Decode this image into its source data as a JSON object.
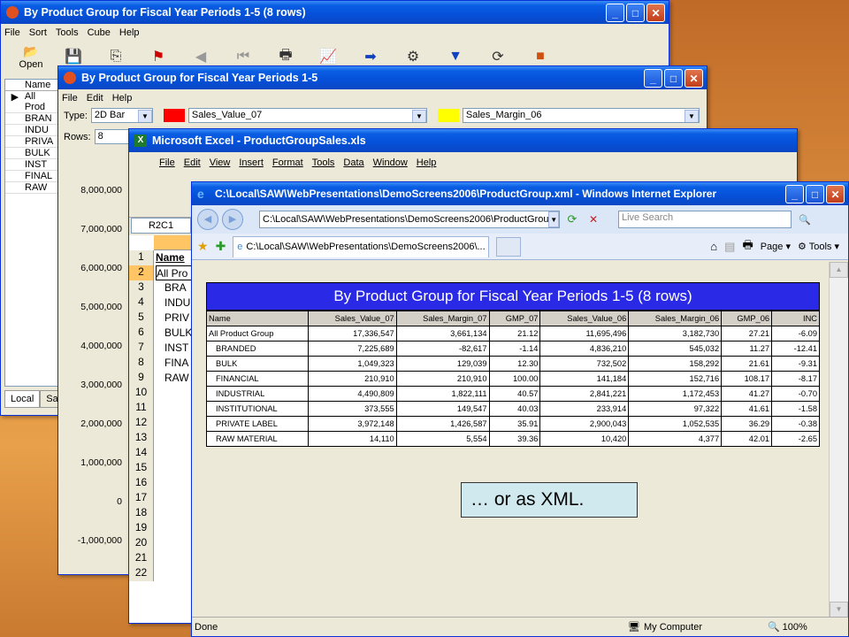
{
  "cube_window": {
    "title": "By Product Group for Fiscal Year Periods 1-5  (8 rows)",
    "menu": [
      "File",
      "Sort",
      "Tools",
      "Cube",
      "Help"
    ],
    "open_label": "Open",
    "rows": [
      "Name",
      "All Prod",
      "BRAN",
      "INDU",
      "PRIVA",
      "BULK",
      "INST",
      "FINAL",
      "RAW"
    ],
    "tabs": [
      "Local",
      "Sa"
    ]
  },
  "chart_window": {
    "title": "By Product Group for Fiscal Year Periods 1-5",
    "menu": [
      "File",
      "Edit",
      "Help"
    ],
    "type_label": "Type:",
    "type_value": "2D Bar",
    "series1": "Sales_Value_07",
    "series2": "Sales_Margin_06",
    "rows_label": "Rows:",
    "rows_value": "8",
    "y_ticks": [
      "8,000,000",
      "7,000,000",
      "6,000,000",
      "5,000,000",
      "4,000,000",
      "3,000,000",
      "2,000,000",
      "1,000,000",
      "0",
      "-1,000,000"
    ],
    "color1": "#ff0000",
    "color2": "#ffff00"
  },
  "excel_window": {
    "title": "Microsoft Excel - ProductGroupSales.xls",
    "menu": [
      "File",
      "Edit",
      "View",
      "Insert",
      "Format",
      "Tools",
      "Data",
      "Window",
      "Help"
    ],
    "name_box": "R2C1",
    "row_numbers": [
      "1",
      "2",
      "3",
      "4",
      "5",
      "6",
      "7",
      "8",
      "9",
      "10",
      "11",
      "12",
      "13",
      "14",
      "15",
      "16",
      "17",
      "18",
      "19",
      "20",
      "21",
      "22"
    ],
    "cells": [
      "Name",
      "All Pro",
      "BRA",
      "INDU",
      "PRIV",
      "BULK",
      "INST",
      "FINA",
      "RAW"
    ]
  },
  "ie_window": {
    "title": "C:\\Local\\SAW\\WebPresentations\\DemoScreens2006\\ProductGroup.xml - Windows Internet Explorer",
    "address": "C:\\Local\\SAW\\WebPresentations\\DemoScreens2006\\ProductGrou",
    "search_placeholder": "Live Search",
    "tab_label": "C:\\Local\\SAW\\WebPresentations\\DemoScreens2006\\...",
    "page_label": "Page",
    "tools_label": "Tools",
    "status_left": "Done",
    "status_zone": "My Computer",
    "zoom": "100%"
  },
  "report": {
    "title": "By Product Group for Fiscal Year Periods 1-5 (8 rows)",
    "headers": [
      "Name",
      "Sales_Value_07",
      "Sales_Margin_07",
      "GMP_07",
      "Sales_Value_06",
      "Sales_Margin_06",
      "GMP_06",
      "INC"
    ],
    "rows": [
      [
        "All Product Group",
        "17,336,547",
        "3,661,134",
        "21.12",
        "11,695,496",
        "3,182,730",
        "27.21",
        "-6.09"
      ],
      [
        "BRANDED",
        "7,225,689",
        "-82,617",
        "-1.14",
        "4,836,210",
        "545,032",
        "11.27",
        "-12.41"
      ],
      [
        "BULK",
        "1,049,323",
        "129,039",
        "12.30",
        "732,502",
        "158,292",
        "21.61",
        "-9.31"
      ],
      [
        "FINANCIAL",
        "210,910",
        "210,910",
        "100.00",
        "141,184",
        "152,716",
        "108.17",
        "-8.17"
      ],
      [
        "INDUSTRIAL",
        "4,490,809",
        "1,822,111",
        "40.57",
        "2,841,221",
        "1,172,453",
        "41.27",
        "-0.70"
      ],
      [
        "INSTITUTIONAL",
        "373,555",
        "149,547",
        "40.03",
        "233,914",
        "97,322",
        "41.61",
        "-1.58"
      ],
      [
        "PRIVATE LABEL",
        "3,972,148",
        "1,426,587",
        "35.91",
        "2,900,043",
        "1,052,535",
        "36.29",
        "-0.38"
      ],
      [
        "RAW MATERIAL",
        "14,110",
        "5,554",
        "39.36",
        "10,420",
        "4,377",
        "42.01",
        "-2.65"
      ]
    ]
  },
  "callout": "… or as XML."
}
